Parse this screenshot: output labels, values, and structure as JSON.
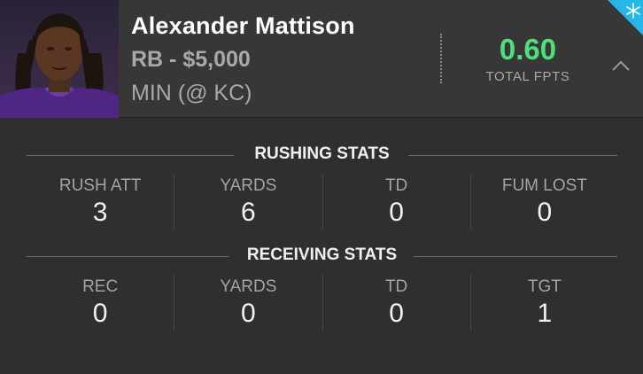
{
  "player": {
    "name": "Alexander Mattison",
    "position_salary": "RB - $5,000",
    "matchup": "MIN (@ KC)"
  },
  "fpts": {
    "value": "0.60",
    "label": "TOTAL FPTS"
  },
  "icons": {
    "collapse": "chevron-up-icon",
    "badge": "snowflake-icon"
  },
  "colors": {
    "fpts": "#4ee07a",
    "badge": "#26b6e8",
    "jersey": "#4f2683"
  },
  "rushing": {
    "title": "RUSHING STATS",
    "stats": [
      {
        "label": "RUSH ATT",
        "value": "3"
      },
      {
        "label": "YARDS",
        "value": "6"
      },
      {
        "label": "TD",
        "value": "0"
      },
      {
        "label": "FUM LOST",
        "value": "0"
      }
    ]
  },
  "receiving": {
    "title": "RECEIVING STATS",
    "stats": [
      {
        "label": "REC",
        "value": "0"
      },
      {
        "label": "YARDS",
        "value": "0"
      },
      {
        "label": "TD",
        "value": "0"
      },
      {
        "label": "TGT",
        "value": "1"
      }
    ]
  }
}
